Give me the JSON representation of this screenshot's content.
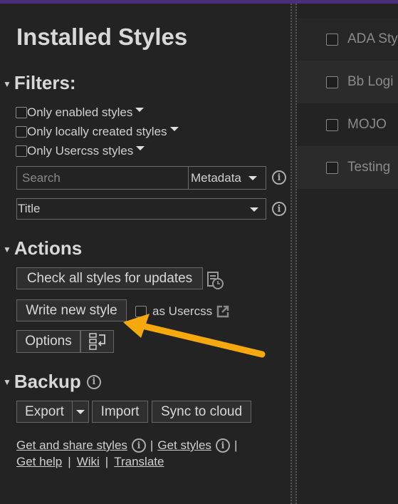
{
  "header": {
    "title": "Installed Styles"
  },
  "filters": {
    "heading": "Filters:",
    "checkboxes": [
      {
        "label": "Only enabled styles",
        "checked": false
      },
      {
        "label": "Only locally created styles",
        "checked": false
      },
      {
        "label": "Only Usercss styles",
        "checked": false
      }
    ],
    "search_placeholder": "Search",
    "search_value": "",
    "search_mode": "Metadata",
    "sort_value": "Title"
  },
  "actions": {
    "heading": "Actions",
    "check_updates": "Check all styles for updates",
    "write_new": "Write new style",
    "as_usercss": "as Usercss",
    "as_usercss_checked": false,
    "options": "Options"
  },
  "backup": {
    "heading": "Backup",
    "export": "Export",
    "import": "Import",
    "sync": "Sync to cloud"
  },
  "links": {
    "get_share": "Get and share styles",
    "sep": "|",
    "get_styles": "Get styles",
    "get_help": "Get help",
    "wiki": "Wiki",
    "translate": "Translate"
  },
  "styles": [
    {
      "name": "ADA Sty"
    },
    {
      "name": "Bb Logi"
    },
    {
      "name": "MOJO"
    },
    {
      "name": "Testing"
    }
  ],
  "colors": {
    "accent_topbar": "#4b2e7d",
    "annotation_arrow": "#f5a90c",
    "background": "#232323"
  }
}
